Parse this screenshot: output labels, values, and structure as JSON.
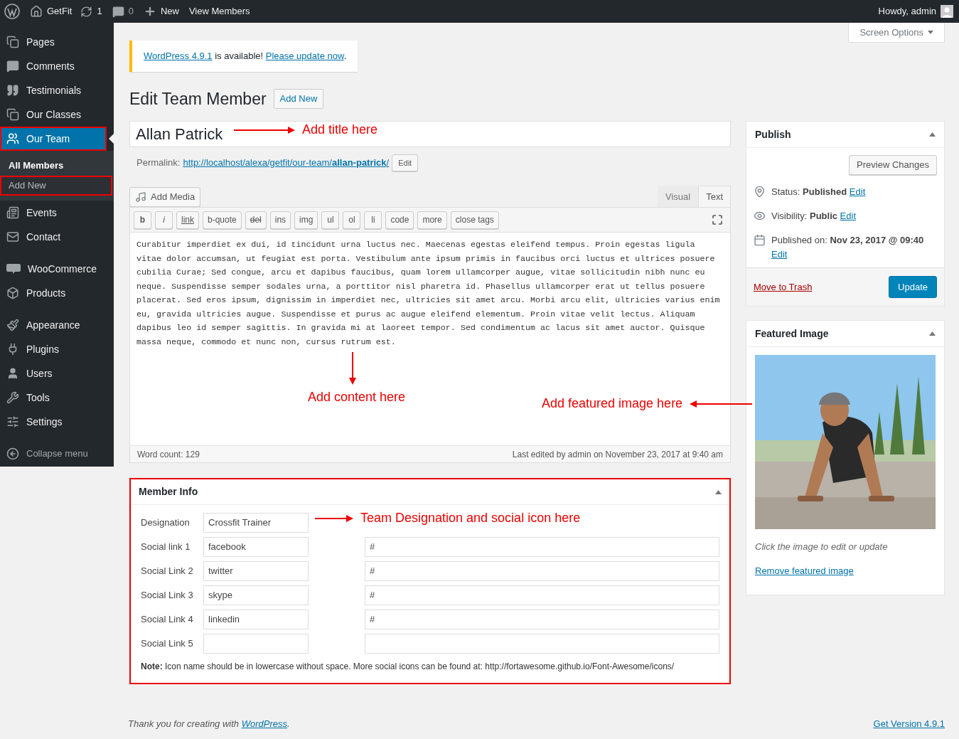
{
  "admin_bar": {
    "site": "GetFit",
    "updates": "1",
    "comments": "0",
    "new": "New",
    "view": "View Members",
    "greeting": "Howdy, admin"
  },
  "sidebar": {
    "groups": [
      {
        "items": [
          {
            "label": "Pages",
            "kind": "pages",
            "selected": false,
            "highlighted": false
          },
          {
            "label": "Comments",
            "kind": "comments",
            "selected": false,
            "highlighted": false
          },
          {
            "label": "Testimonials",
            "kind": "quote",
            "selected": false,
            "highlighted": false
          },
          {
            "label": "Our Classes",
            "kind": "pages",
            "selected": false,
            "highlighted": false
          },
          {
            "label": "Our Team",
            "kind": "team",
            "selected": true,
            "highlighted": true,
            "children": [
              {
                "label": "All Members",
                "selected": true,
                "highlighted": false
              },
              {
                "label": "Add New",
                "selected": false,
                "highlighted": true
              }
            ]
          },
          {
            "label": "Events",
            "kind": "events",
            "selected": false,
            "highlighted": false
          },
          {
            "label": "Contact",
            "kind": "mail",
            "selected": false,
            "highlighted": false
          }
        ]
      },
      {
        "items": [
          {
            "label": "WooCommerce",
            "kind": "woo",
            "selected": false,
            "highlighted": false
          },
          {
            "label": "Products",
            "kind": "box",
            "selected": false,
            "highlighted": false
          }
        ]
      },
      {
        "items": [
          {
            "label": "Appearance",
            "kind": "brush",
            "selected": false,
            "highlighted": false
          },
          {
            "label": "Plugins",
            "kind": "plug",
            "selected": false,
            "highlighted": false
          },
          {
            "label": "Users",
            "kind": "user",
            "selected": false,
            "highlighted": false
          },
          {
            "label": "Tools",
            "kind": "wrench",
            "selected": false,
            "highlighted": false
          },
          {
            "label": "Settings",
            "kind": "sliders",
            "selected": false,
            "highlighted": false
          }
        ]
      }
    ],
    "collapse": "Collapse menu"
  },
  "screen_options": "Screen Options",
  "notice": {
    "link": "WordPress 4.9.1",
    "text": " is available! ",
    "action": "Please update now",
    "end": "."
  },
  "heading": "Edit Team Member",
  "add_new": "Add New",
  "title_value": "Allan Patrick",
  "permalink": {
    "label": "Permalink:",
    "url": "http://localhost/alexa/getfit/our-team/**allan-patrick**/",
    "edit": "Edit"
  },
  "editor": {
    "add_media": "Add Media",
    "tabs": [
      {
        "label": "Visual",
        "selected": false
      },
      {
        "label": "Text",
        "selected": true
      }
    ],
    "quicktags": [
      {
        "label": "b",
        "kind": "bold"
      },
      {
        "label": "i",
        "kind": "italic"
      },
      {
        "label": "link",
        "kind": "underline"
      },
      {
        "label": "b-quote",
        "kind": "plain"
      },
      {
        "label": "del",
        "kind": "strike"
      },
      {
        "label": "ins",
        "kind": "plain"
      },
      {
        "label": "img",
        "kind": "plain"
      },
      {
        "label": "ul",
        "kind": "plain"
      },
      {
        "label": "ol",
        "kind": "plain"
      },
      {
        "label": "li",
        "kind": "plain"
      },
      {
        "label": "code",
        "kind": "plain"
      },
      {
        "label": "more",
        "kind": "plain"
      },
      {
        "label": "close tags",
        "kind": "plain"
      }
    ],
    "content": "Curabitur imperdiet ex dui, id tincidunt urna luctus nec. Maecenas egestas eleifend tempus. Proin egestas ligula vitae dolor accumsan, ut feugiat est porta. Vestibulum ante ipsum primis in faucibus orci luctus et ultrices posuere cubilia Curae; Sed congue, arcu et dapibus faucibus, quam lorem ullamcorper augue, vitae sollicitudin nibh nunc eu neque. Suspendisse semper sodales urna, a porttitor nisl pharetra id. Phasellus ullamcorper erat ut tellus posuere placerat. Sed eros ipsum, dignissim in imperdiet nec, ultricies sit amet arcu. Morbi arcu elit, ultricies varius enim eu, gravida ultricies augue. Suspendisse et purus ac augue eleifend elementum. Proin vitae velit lectus. Aliquam dapibus leo id semper sagittis. In gravida mi at laoreet tempor. Sed condimentum ac lacus sit amet auctor. Quisque massa neque, commodo et nunc non, cursus rutrum est.",
    "word_count": "Word count: 129",
    "last_edited": "Last edited by admin on November 23, 2017 at 9:40 am"
  },
  "member_info": {
    "title": "Member Info",
    "highlighted": true,
    "designation": {
      "label": "Designation",
      "value": "Crossfit Trainer"
    },
    "social_links": [
      {
        "label": "Social link 1",
        "icon": "facebook",
        "url": "#"
      },
      {
        "label": "Social Link 2",
        "icon": "twitter",
        "url": "#"
      },
      {
        "label": "Social Link 3",
        "icon": "skype",
        "url": "#"
      },
      {
        "label": "Social Link 4",
        "icon": "linkedin",
        "url": "#"
      },
      {
        "label": "Social Link 5"
      }
    ],
    "note": "**Note:** Icon name should be in lowercase without space. More social icons can be found at: http://fortawesome.github.io/Font-Awesome/icons/"
  },
  "publish": {
    "title": "Publish",
    "preview": "Preview Changes",
    "rows": [
      {
        "kind": "status",
        "label": "Status:",
        "value": "Published",
        "edit": "Edit"
      },
      {
        "kind": "visibility",
        "label": "Visibility:",
        "value": "Public",
        "edit": "Edit"
      },
      {
        "kind": "date",
        "label": "Published on:",
        "value": "Nov 23, 2017 @ 09:40",
        "edit": "Edit"
      }
    ],
    "trash": "Move to Trash",
    "update": "Update"
  },
  "featured_image": {
    "title": "Featured Image",
    "caption": "Click the image to edit or update",
    "remove": "Remove featured image"
  },
  "annotations": [
    {
      "kind": "title",
      "text": "Add title here"
    },
    {
      "kind": "content",
      "text": "Add content here"
    },
    {
      "text": "Add featured image here"
    },
    {
      "kind": "member",
      "text": "Team Designation and social icon here"
    }
  ],
  "footer": {
    "thanks": "Thank you for creating with ",
    "link": "WordPress",
    "end": ".",
    "version": "Get Version 4.9.1"
  }
}
